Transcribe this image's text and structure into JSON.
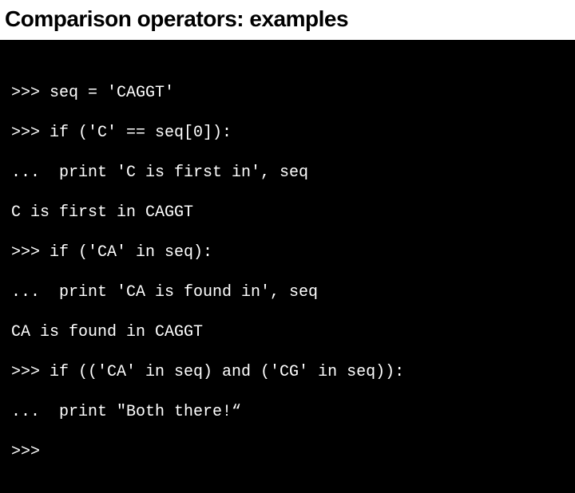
{
  "title": "Comparison operators: examples",
  "code_lines": [
    ">>> seq = 'CAGGT'",
    ">>> if ('C' == seq[0]):",
    "...  print 'C is first in', seq",
    "C is first in CAGGT",
    ">>> if ('CA' in seq):",
    "...  print 'CA is found in', seq",
    "CA is found in CAGGT",
    ">>> if (('CA' in seq) and ('CG' in seq)):",
    "...  print \"Both there!“",
    ">>>"
  ]
}
